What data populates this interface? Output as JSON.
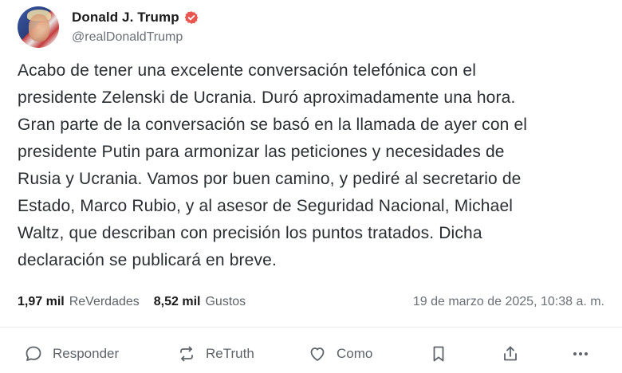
{
  "author": {
    "display_name": "Donald J. Trump",
    "handle": "@realDonaldTrump",
    "verified_icon": "verified-badge-icon",
    "avatar": "avatar"
  },
  "post": {
    "text": "Acabo de tener una excelente conversación telefónica con el\npresidente Zelenski de Ucrania. Duró aproximadamente una hora.\nGran parte de la conversación se basó en la llamada de ayer con el\npresidente Putin para armonizar las peticiones y necesidades de\nRusia y Ucrania. Vamos por buen camino, y pediré al secretario de\nEstado, Marco Rubio, y al asesor de Seguridad Nacional, Michael\nWaltz, que describan con precisión los puntos tratados. Dicha\ndeclaración se publicará en breve."
  },
  "stats": {
    "retruths_count": "1,97 mil",
    "retruths_label": "ReVerdades",
    "likes_count": "8,52 mil",
    "likes_label": "Gustos",
    "timestamp": "19 de marzo de 2025, 10:38 a. m."
  },
  "actions": {
    "reply_label": "Responder",
    "retruth_label": "ReTruth",
    "like_label": "Como"
  },
  "colors": {
    "accent_verified": "#e8564f",
    "text_primary": "#1a1a1a",
    "text_secondary": "#6b6f76",
    "divider": "#ececef"
  }
}
